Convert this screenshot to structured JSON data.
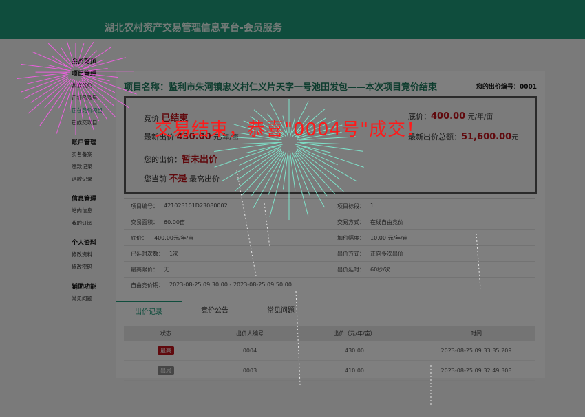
{
  "app": {
    "title": "湖北农村资产交易管理信息平台-会员服务"
  },
  "sidebar": {
    "home": "会员首页",
    "sections": [
      {
        "title": "项目管理",
        "items": [
          "我要竞价",
          "已报名项目",
          "正在竞价项目",
          "已成交项目"
        ]
      },
      {
        "title": "账户管理",
        "items": [
          "实名备案",
          "缴款记录",
          "退款记录"
        ]
      },
      {
        "title": "信息管理",
        "items": [
          "站内信息",
          "我的订阅"
        ]
      },
      {
        "title": "个人资料",
        "items": [
          "修改资料",
          "修改密码"
        ]
      },
      {
        "title": "辅助功能",
        "items": [
          "常见问题"
        ]
      }
    ]
  },
  "project": {
    "title": "项目名称：监利市朱河镇忠义村仁义片天字一号池田发包——本次项目竞价结束",
    "my_bid_number_label": "您的出价编号：",
    "my_bid_number": "0001"
  },
  "status": {
    "bid_label": "竞价",
    "bid_status": "已结束",
    "floor_label": "底价：",
    "floor_value": "400.00",
    "floor_unit": "元/年/亩",
    "latest_label": "最新出价",
    "latest_value": "430.00",
    "latest_unit": "元/年/亩",
    "total_label": "最新出价总额：",
    "total_value": "51,600.00",
    "total_unit": "元",
    "your_bid_label": "您的出价：",
    "your_bid_value": "暂未出价",
    "current_label": "您当前",
    "current_value": "不是",
    "current_suffix": "最高出价",
    "congrats": "交易结束，恭喜\"0004号\"成交！"
  },
  "details": {
    "rows": [
      {
        "left_label": "项目编号：",
        "left_value": "421023101D23080002",
        "right_label": "项目标段：",
        "right_value": "1"
      },
      {
        "left_label": "交易面积：",
        "left_value": "60.00亩",
        "right_label": "交易方式：",
        "right_value": "在线自由竞价"
      },
      {
        "left_label": "底价：",
        "left_value": "400.00元/年/亩",
        "right_label": "加价幅度：",
        "right_value": "10.00 元/年/亩"
      },
      {
        "left_label": "已延时次数：",
        "left_value": "1次",
        "right_label": "出价方式：",
        "right_value": "正向多次出价"
      },
      {
        "left_label": "最高限价：",
        "left_value": "无",
        "right_label": "出价延时：",
        "right_value": "60秒/次"
      },
      {
        "left_label": "自由竞价期：",
        "left_value": "2023-08-25 09:30:00 - 2023-08-25 09:50:00",
        "right_label": "",
        "right_value": ""
      }
    ]
  },
  "tabs": [
    "出价记录",
    "竞价公告",
    "常见问题"
  ],
  "bid_table": {
    "headers": [
      "状态",
      "出价人编号",
      "出价（元/年/亩）",
      "时间"
    ],
    "rows": [
      {
        "status": "最高",
        "status_color": "#c0121b",
        "bidder": "0004",
        "price": "430.00",
        "time": "2023-08-25 09:33:35:209"
      },
      {
        "status": "出局",
        "status_color": "#8c8c8c",
        "bidder": "0003",
        "price": "410.00",
        "time": "2023-08-25 09:32:49:308"
      }
    ]
  }
}
